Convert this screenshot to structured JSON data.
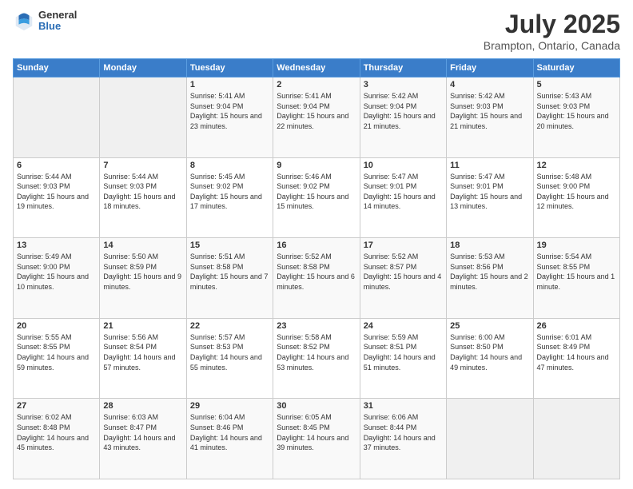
{
  "header": {
    "logo_general": "General",
    "logo_blue": "Blue",
    "title": "July 2025",
    "subtitle": "Brampton, Ontario, Canada"
  },
  "weekdays": [
    "Sunday",
    "Monday",
    "Tuesday",
    "Wednesday",
    "Thursday",
    "Friday",
    "Saturday"
  ],
  "weeks": [
    [
      {
        "day": "",
        "empty": true
      },
      {
        "day": "",
        "empty": true
      },
      {
        "day": "1",
        "sunrise": "Sunrise: 5:41 AM",
        "sunset": "Sunset: 9:04 PM",
        "daylight": "Daylight: 15 hours and 23 minutes."
      },
      {
        "day": "2",
        "sunrise": "Sunrise: 5:41 AM",
        "sunset": "Sunset: 9:04 PM",
        "daylight": "Daylight: 15 hours and 22 minutes."
      },
      {
        "day": "3",
        "sunrise": "Sunrise: 5:42 AM",
        "sunset": "Sunset: 9:04 PM",
        "daylight": "Daylight: 15 hours and 21 minutes."
      },
      {
        "day": "4",
        "sunrise": "Sunrise: 5:42 AM",
        "sunset": "Sunset: 9:03 PM",
        "daylight": "Daylight: 15 hours and 21 minutes."
      },
      {
        "day": "5",
        "sunrise": "Sunrise: 5:43 AM",
        "sunset": "Sunset: 9:03 PM",
        "daylight": "Daylight: 15 hours and 20 minutes."
      }
    ],
    [
      {
        "day": "6",
        "sunrise": "Sunrise: 5:44 AM",
        "sunset": "Sunset: 9:03 PM",
        "daylight": "Daylight: 15 hours and 19 minutes."
      },
      {
        "day": "7",
        "sunrise": "Sunrise: 5:44 AM",
        "sunset": "Sunset: 9:03 PM",
        "daylight": "Daylight: 15 hours and 18 minutes."
      },
      {
        "day": "8",
        "sunrise": "Sunrise: 5:45 AM",
        "sunset": "Sunset: 9:02 PM",
        "daylight": "Daylight: 15 hours and 17 minutes."
      },
      {
        "day": "9",
        "sunrise": "Sunrise: 5:46 AM",
        "sunset": "Sunset: 9:02 PM",
        "daylight": "Daylight: 15 hours and 15 minutes."
      },
      {
        "day": "10",
        "sunrise": "Sunrise: 5:47 AM",
        "sunset": "Sunset: 9:01 PM",
        "daylight": "Daylight: 15 hours and 14 minutes."
      },
      {
        "day": "11",
        "sunrise": "Sunrise: 5:47 AM",
        "sunset": "Sunset: 9:01 PM",
        "daylight": "Daylight: 15 hours and 13 minutes."
      },
      {
        "day": "12",
        "sunrise": "Sunrise: 5:48 AM",
        "sunset": "Sunset: 9:00 PM",
        "daylight": "Daylight: 15 hours and 12 minutes."
      }
    ],
    [
      {
        "day": "13",
        "sunrise": "Sunrise: 5:49 AM",
        "sunset": "Sunset: 9:00 PM",
        "daylight": "Daylight: 15 hours and 10 minutes."
      },
      {
        "day": "14",
        "sunrise": "Sunrise: 5:50 AM",
        "sunset": "Sunset: 8:59 PM",
        "daylight": "Daylight: 15 hours and 9 minutes."
      },
      {
        "day": "15",
        "sunrise": "Sunrise: 5:51 AM",
        "sunset": "Sunset: 8:58 PM",
        "daylight": "Daylight: 15 hours and 7 minutes."
      },
      {
        "day": "16",
        "sunrise": "Sunrise: 5:52 AM",
        "sunset": "Sunset: 8:58 PM",
        "daylight": "Daylight: 15 hours and 6 minutes."
      },
      {
        "day": "17",
        "sunrise": "Sunrise: 5:52 AM",
        "sunset": "Sunset: 8:57 PM",
        "daylight": "Daylight: 15 hours and 4 minutes."
      },
      {
        "day": "18",
        "sunrise": "Sunrise: 5:53 AM",
        "sunset": "Sunset: 8:56 PM",
        "daylight": "Daylight: 15 hours and 2 minutes."
      },
      {
        "day": "19",
        "sunrise": "Sunrise: 5:54 AM",
        "sunset": "Sunset: 8:55 PM",
        "daylight": "Daylight: 15 hours and 1 minute."
      }
    ],
    [
      {
        "day": "20",
        "sunrise": "Sunrise: 5:55 AM",
        "sunset": "Sunset: 8:55 PM",
        "daylight": "Daylight: 14 hours and 59 minutes."
      },
      {
        "day": "21",
        "sunrise": "Sunrise: 5:56 AM",
        "sunset": "Sunset: 8:54 PM",
        "daylight": "Daylight: 14 hours and 57 minutes."
      },
      {
        "day": "22",
        "sunrise": "Sunrise: 5:57 AM",
        "sunset": "Sunset: 8:53 PM",
        "daylight": "Daylight: 14 hours and 55 minutes."
      },
      {
        "day": "23",
        "sunrise": "Sunrise: 5:58 AM",
        "sunset": "Sunset: 8:52 PM",
        "daylight": "Daylight: 14 hours and 53 minutes."
      },
      {
        "day": "24",
        "sunrise": "Sunrise: 5:59 AM",
        "sunset": "Sunset: 8:51 PM",
        "daylight": "Daylight: 14 hours and 51 minutes."
      },
      {
        "day": "25",
        "sunrise": "Sunrise: 6:00 AM",
        "sunset": "Sunset: 8:50 PM",
        "daylight": "Daylight: 14 hours and 49 minutes."
      },
      {
        "day": "26",
        "sunrise": "Sunrise: 6:01 AM",
        "sunset": "Sunset: 8:49 PM",
        "daylight": "Daylight: 14 hours and 47 minutes."
      }
    ],
    [
      {
        "day": "27",
        "sunrise": "Sunrise: 6:02 AM",
        "sunset": "Sunset: 8:48 PM",
        "daylight": "Daylight: 14 hours and 45 minutes."
      },
      {
        "day": "28",
        "sunrise": "Sunrise: 6:03 AM",
        "sunset": "Sunset: 8:47 PM",
        "daylight": "Daylight: 14 hours and 43 minutes."
      },
      {
        "day": "29",
        "sunrise": "Sunrise: 6:04 AM",
        "sunset": "Sunset: 8:46 PM",
        "daylight": "Daylight: 14 hours and 41 minutes."
      },
      {
        "day": "30",
        "sunrise": "Sunrise: 6:05 AM",
        "sunset": "Sunset: 8:45 PM",
        "daylight": "Daylight: 14 hours and 39 minutes."
      },
      {
        "day": "31",
        "sunrise": "Sunrise: 6:06 AM",
        "sunset": "Sunset: 8:44 PM",
        "daylight": "Daylight: 14 hours and 37 minutes."
      },
      {
        "day": "",
        "empty": true
      },
      {
        "day": "",
        "empty": true
      }
    ]
  ]
}
